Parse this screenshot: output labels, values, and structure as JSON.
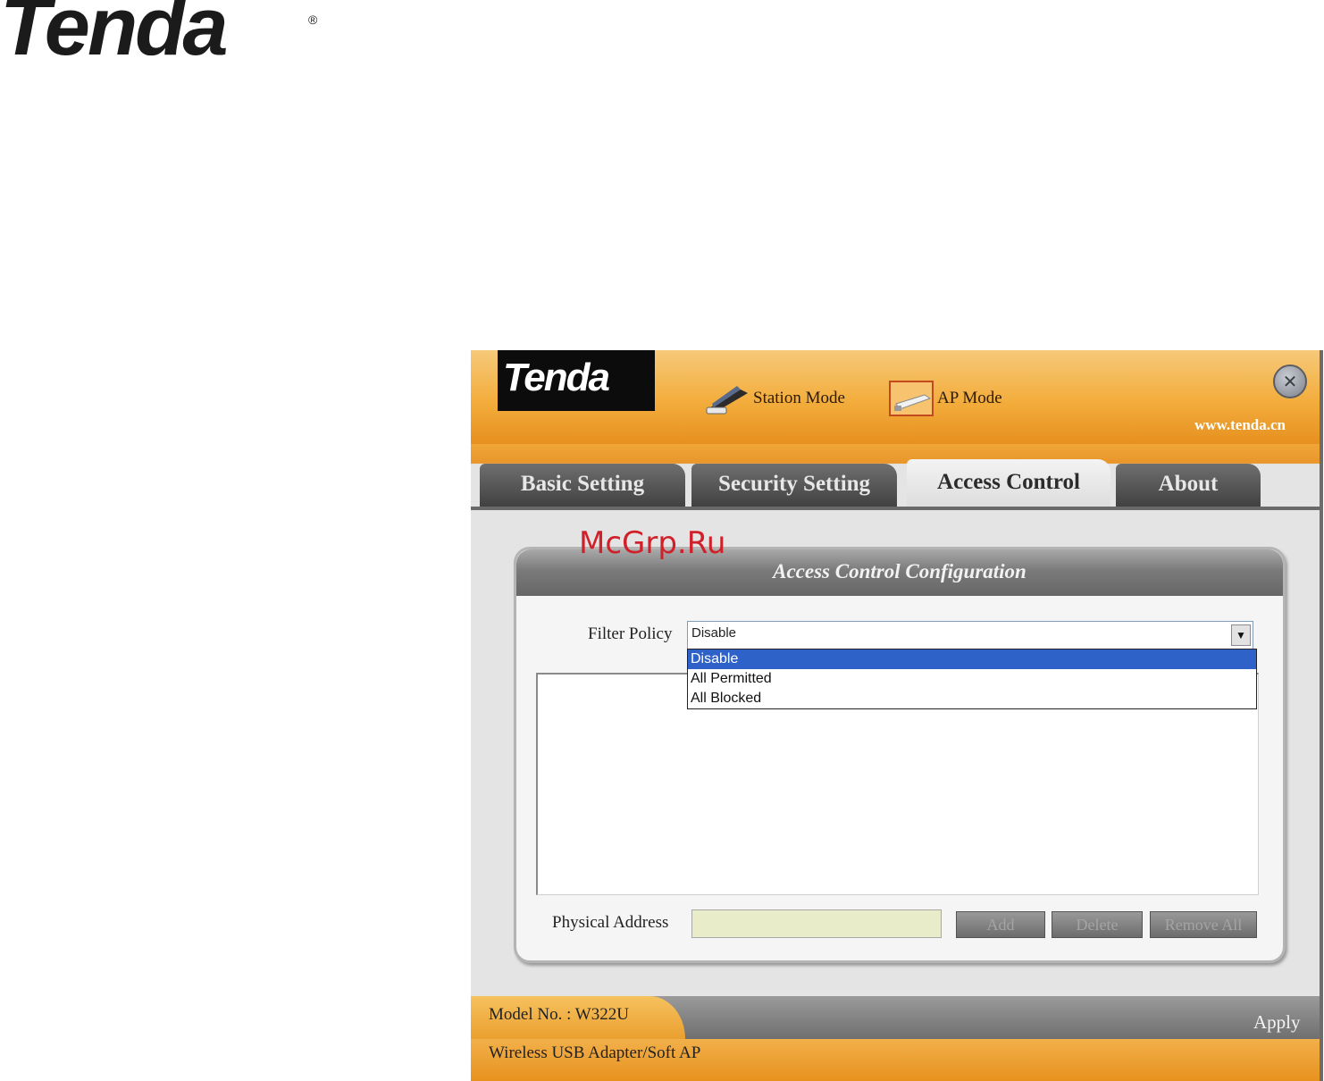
{
  "page": {
    "brand_logo": "Tenda",
    "watermark": "McGrp.Ru"
  },
  "window": {
    "logo_text": "Tenda",
    "modes": {
      "station": "Station Mode",
      "ap": "AP Mode"
    },
    "url": "www.tenda.cn",
    "close_icon": "close-icon"
  },
  "tabs": [
    {
      "label": "Basic Setting",
      "active": false
    },
    {
      "label": "Security Setting",
      "active": false
    },
    {
      "label": "Access Control",
      "active": true
    },
    {
      "label": "About",
      "active": false
    }
  ],
  "panel": {
    "title": "Access Control Configuration",
    "filter_policy": {
      "label": "Filter Policy",
      "value": "Disable",
      "options": [
        "Disable",
        "All Permitted",
        "All Blocked"
      ],
      "highlighted_option": "Disable"
    },
    "physical_address": {
      "label": "Physical Address",
      "value": ""
    },
    "buttons": {
      "add": "Add",
      "delete": "Delete",
      "remove_all": "Remove All"
    }
  },
  "footer": {
    "model": "Model No. : W322U",
    "product": "Wireless USB Adapter/Soft AP",
    "apply": "Apply"
  },
  "colors": {
    "header_orange": "#f3ad3c",
    "tab_dark": "#4a4a4a",
    "selection_blue": "#2f62c9",
    "input_yellow": "#e8ecc9"
  }
}
